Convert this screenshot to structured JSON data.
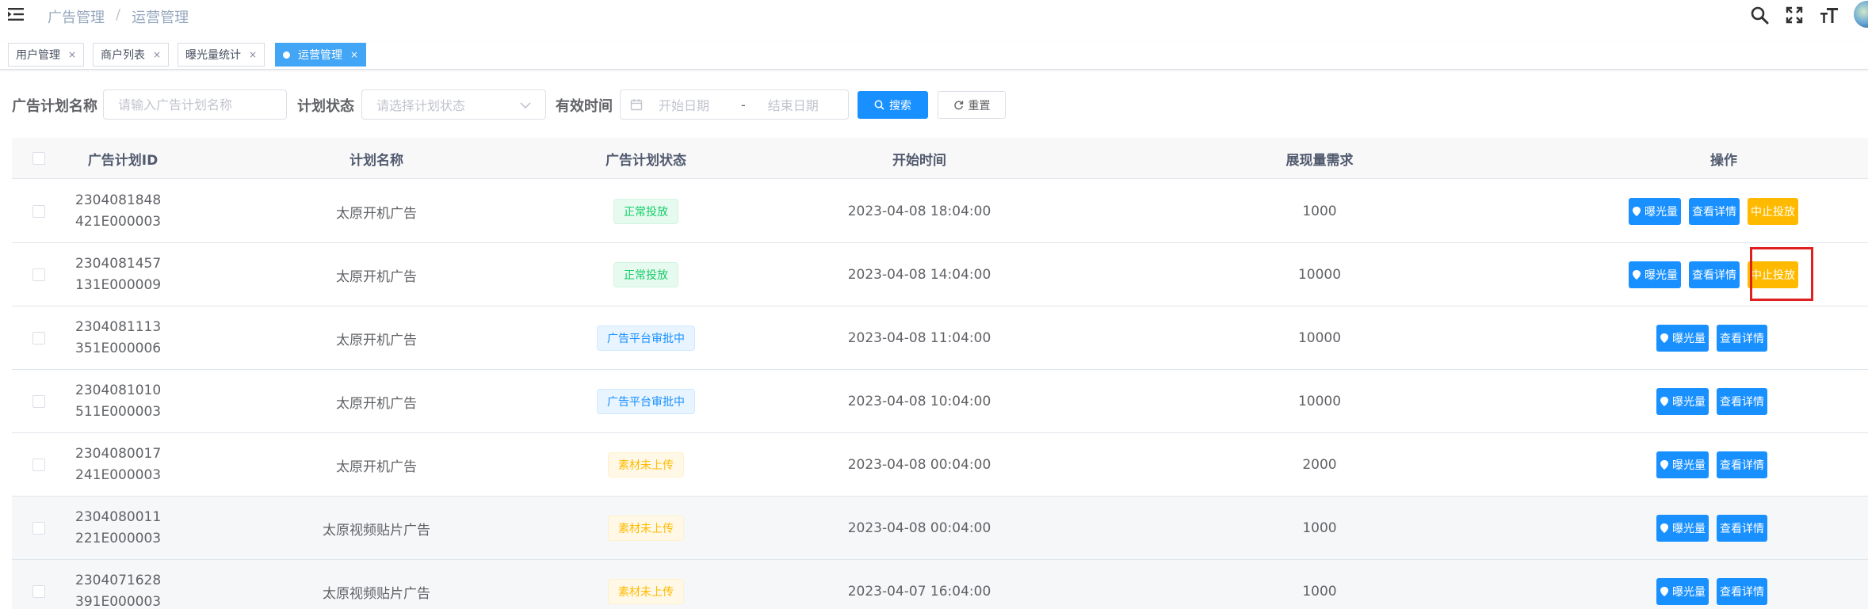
{
  "navbar": {
    "breadcrumb": [
      "广告管理",
      "运营管理"
    ],
    "breadcrumb_separator": "/",
    "icons": [
      "hamburger-icon",
      "search-icon",
      "fullscreen-icon",
      "font-size-icon",
      "avatar"
    ]
  },
  "tags": [
    {
      "label": "用户管理",
      "active": false
    },
    {
      "label": "商户列表",
      "active": false
    },
    {
      "label": "曝光量统计",
      "active": false
    },
    {
      "label": "运营管理",
      "active": true
    }
  ],
  "tag_close_glyph": "×",
  "search_form": {
    "plan_name_label": "广告计划名称",
    "plan_name_placeholder": "请输入广告计划名称",
    "plan_status_label": "计划状态",
    "plan_status_placeholder": "请选择计划状态",
    "valid_time_label": "有效时间",
    "start_date_placeholder": "开始日期",
    "range_separator": "-",
    "end_date_placeholder": "结束日期",
    "search_button": "搜索",
    "reset_button": "重置"
  },
  "table": {
    "columns": [
      "广告计划ID",
      "计划名称",
      "广告计划状态",
      "开始时间",
      "展现量需求",
      "操作"
    ],
    "rows": [
      {
        "id": "2304081848421E000003",
        "name": "太原开机广告",
        "status": "正常投放",
        "status_kind": "success",
        "start_time": "2023-04-08 18:04:00",
        "demand": "1000",
        "actions": [
          "曝光量",
          "查看详情",
          "中止投放"
        ],
        "highlight": false
      },
      {
        "id": "2304081457131E000009",
        "name": "太原开机广告",
        "status": "正常投放",
        "status_kind": "success",
        "start_time": "2023-04-08 14:04:00",
        "demand": "10000",
        "actions": [
          "曝光量",
          "查看详情",
          "中止投放"
        ],
        "highlight": true
      },
      {
        "id": "2304081113351E000006",
        "name": "太原开机广告",
        "status": "广告平台审批中",
        "status_kind": "info",
        "start_time": "2023-04-08 11:04:00",
        "demand": "10000",
        "actions": [
          "曝光量",
          "查看详情"
        ],
        "highlight": false
      },
      {
        "id": "2304081010511E000003",
        "name": "太原开机广告",
        "status": "广告平台审批中",
        "status_kind": "info",
        "start_time": "2023-04-08 10:04:00",
        "demand": "10000",
        "actions": [
          "曝光量",
          "查看详情"
        ],
        "highlight": false
      },
      {
        "id": "2304080017241E000003",
        "name": "太原开机广告",
        "status": "素材未上传",
        "status_kind": "warning",
        "start_time": "2023-04-08 00:04:00",
        "demand": "2000",
        "actions": [
          "曝光量",
          "查看详情"
        ],
        "highlight": false
      },
      {
        "id": "2304080011221E000003",
        "name": "太原视频贴片广告",
        "status": "素材未上传",
        "status_kind": "warning",
        "start_time": "2023-04-08 00:04:00",
        "demand": "1000",
        "actions": [
          "曝光量",
          "查看详情"
        ],
        "highlight": false
      },
      {
        "id": "2304071628391E000003",
        "name": "太原视频贴片广告",
        "status": "素材未上传",
        "status_kind": "warning",
        "start_time": "2023-04-07 16:04:00",
        "demand": "1000",
        "actions": [
          "曝光量",
          "查看详情"
        ],
        "highlight": false
      }
    ]
  },
  "colors": {
    "primary": "#1890ff",
    "warning": "#ffba00",
    "success_text": "#13ce66",
    "success_bg": "#e7faf0",
    "success_border": "#d0f5e0",
    "info_text": "#1890ff",
    "info_bg": "#e8f4ff",
    "info_border": "#d1e9ff",
    "warning_text": "#ffba00",
    "warning_bg": "#fff8e6",
    "warning_border": "#fff1cc",
    "highlight_box": "#e02020"
  }
}
